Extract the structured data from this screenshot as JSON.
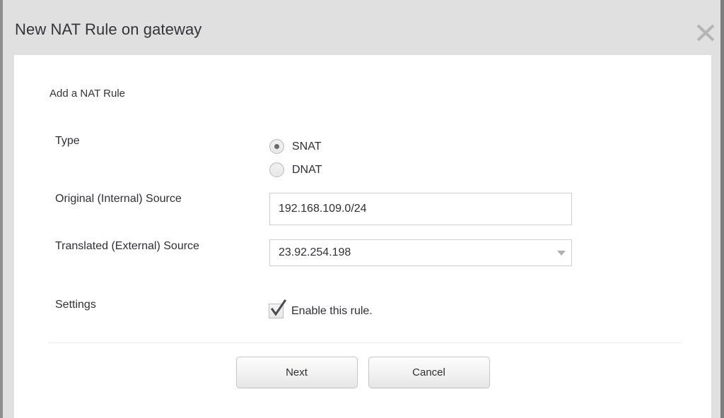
{
  "dialog": {
    "title": "New NAT Rule on gateway",
    "close_icon": "close-icon",
    "section_heading": "Add a NAT Rule"
  },
  "form": {
    "type": {
      "label": "Type",
      "options": [
        {
          "label": "SNAT",
          "selected": true
        },
        {
          "label": "DNAT",
          "selected": false
        }
      ]
    },
    "original_source": {
      "label": "Original (Internal) Source",
      "value": "192.168.109.0/24",
      "placeholder": ""
    },
    "translated_source": {
      "label": "Translated (External) Source",
      "value": "23.92.254.198",
      "dropdown_icon": "chevron-down-icon"
    },
    "settings": {
      "label": "Settings",
      "enable_rule": {
        "label": "Enable this rule.",
        "checked": true
      }
    }
  },
  "footer": {
    "next_label": "Next",
    "cancel_label": "Cancel"
  },
  "colors": {
    "header_bg": "#e0e0e0",
    "body_bg": "#ffffff",
    "text": "#2f2f38",
    "border": "#cfcfcf",
    "close_icon": "#b5b5b5"
  }
}
